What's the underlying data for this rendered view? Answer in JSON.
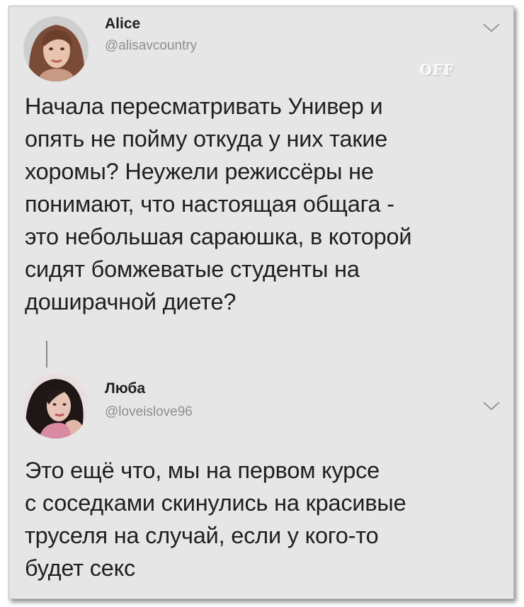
{
  "tweet1": {
    "name": "Alice",
    "handle": "@alisavcountry",
    "avatar_icon": "user-avatar-woman",
    "menu_icon": "chevron-down-icon",
    "text_lines": [
      "Начала пересматривать Универ и",
      "опять не пойму откуда у них такие",
      "хоромы? Неужели режиссёры не",
      "понимают, что настоящая общага -",
      "это небольшая сараюшка, в которой",
      "сидят бомжеватые студенты на",
      "доширачной диете?"
    ]
  },
  "tweet2": {
    "name": "Люба",
    "handle": "@loveislove96",
    "avatar_icon": "user-avatar-woman",
    "menu_icon": "chevron-down-icon",
    "text_lines": [
      "Это ещё что, мы на первом курсе",
      "с соседками скинулись на красивые",
      "труселя на случай, если у кого-то",
      "будет секс"
    ]
  },
  "watermark": "OFF",
  "colors": {
    "background": "#e6e6e6",
    "text": "#1f1f1f",
    "handle": "#8e8e8e",
    "thread_line": "#8a8a8a"
  }
}
